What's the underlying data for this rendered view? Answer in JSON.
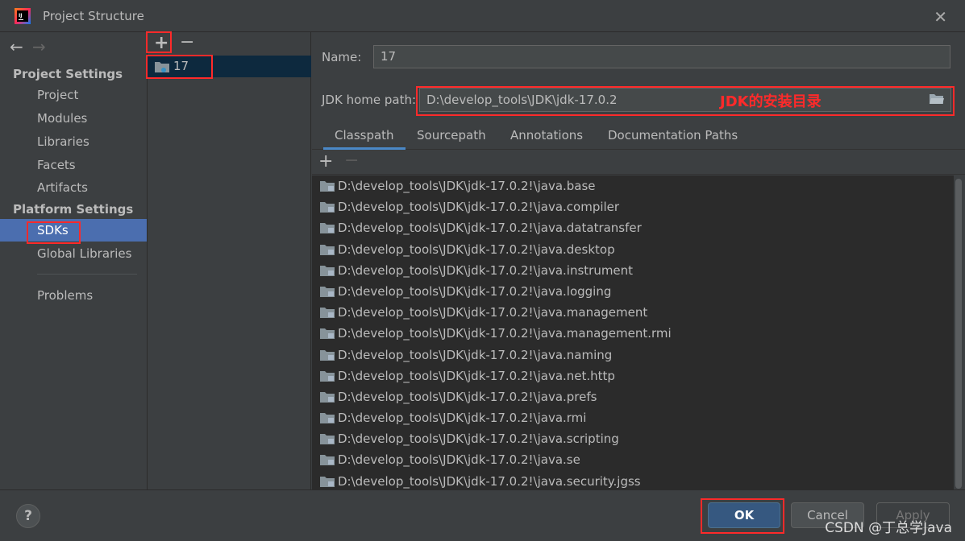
{
  "window": {
    "title": "Project Structure"
  },
  "nav": {
    "project_settings_heading": "Project Settings",
    "project_settings_items": [
      "Project",
      "Modules",
      "Libraries",
      "Facets",
      "Artifacts"
    ],
    "platform_settings_heading": "Platform Settings",
    "platform_settings_items": [
      "SDKs",
      "Global Libraries"
    ],
    "problems_label": "Problems",
    "selected": "SDKs"
  },
  "sdk_list": {
    "items": [
      "17"
    ]
  },
  "detail": {
    "name_label": "Name:",
    "name_value": "17",
    "jdk_home_label": "JDK home path:",
    "jdk_home_value": "D:\\develop_tools\\JDK\\jdk-17.0.2",
    "annotation": "JDK的安装目录",
    "tabs": [
      "Classpath",
      "Sourcepath",
      "Annotations",
      "Documentation Paths"
    ],
    "active_tab": "Classpath",
    "classpath": [
      "D:\\develop_tools\\JDK\\jdk-17.0.2!\\java.base",
      "D:\\develop_tools\\JDK\\jdk-17.0.2!\\java.compiler",
      "D:\\develop_tools\\JDK\\jdk-17.0.2!\\java.datatransfer",
      "D:\\develop_tools\\JDK\\jdk-17.0.2!\\java.desktop",
      "D:\\develop_tools\\JDK\\jdk-17.0.2!\\java.instrument",
      "D:\\develop_tools\\JDK\\jdk-17.0.2!\\java.logging",
      "D:\\develop_tools\\JDK\\jdk-17.0.2!\\java.management",
      "D:\\develop_tools\\JDK\\jdk-17.0.2!\\java.management.rmi",
      "D:\\develop_tools\\JDK\\jdk-17.0.2!\\java.naming",
      "D:\\develop_tools\\JDK\\jdk-17.0.2!\\java.net.http",
      "D:\\develop_tools\\JDK\\jdk-17.0.2!\\java.prefs",
      "D:\\develop_tools\\JDK\\jdk-17.0.2!\\java.rmi",
      "D:\\develop_tools\\JDK\\jdk-17.0.2!\\java.scripting",
      "D:\\develop_tools\\JDK\\jdk-17.0.2!\\java.se",
      "D:\\develop_tools\\JDK\\jdk-17.0.2!\\java.security.jgss"
    ]
  },
  "buttons": {
    "help": "?",
    "ok": "OK",
    "cancel": "Cancel",
    "apply": "Apply"
  },
  "watermark": "CSDN @丁总学Java",
  "colors": {
    "highlight_red": "#ff2a2a",
    "selection_blue": "#4b6eaf",
    "ok_blue": "#365880"
  }
}
